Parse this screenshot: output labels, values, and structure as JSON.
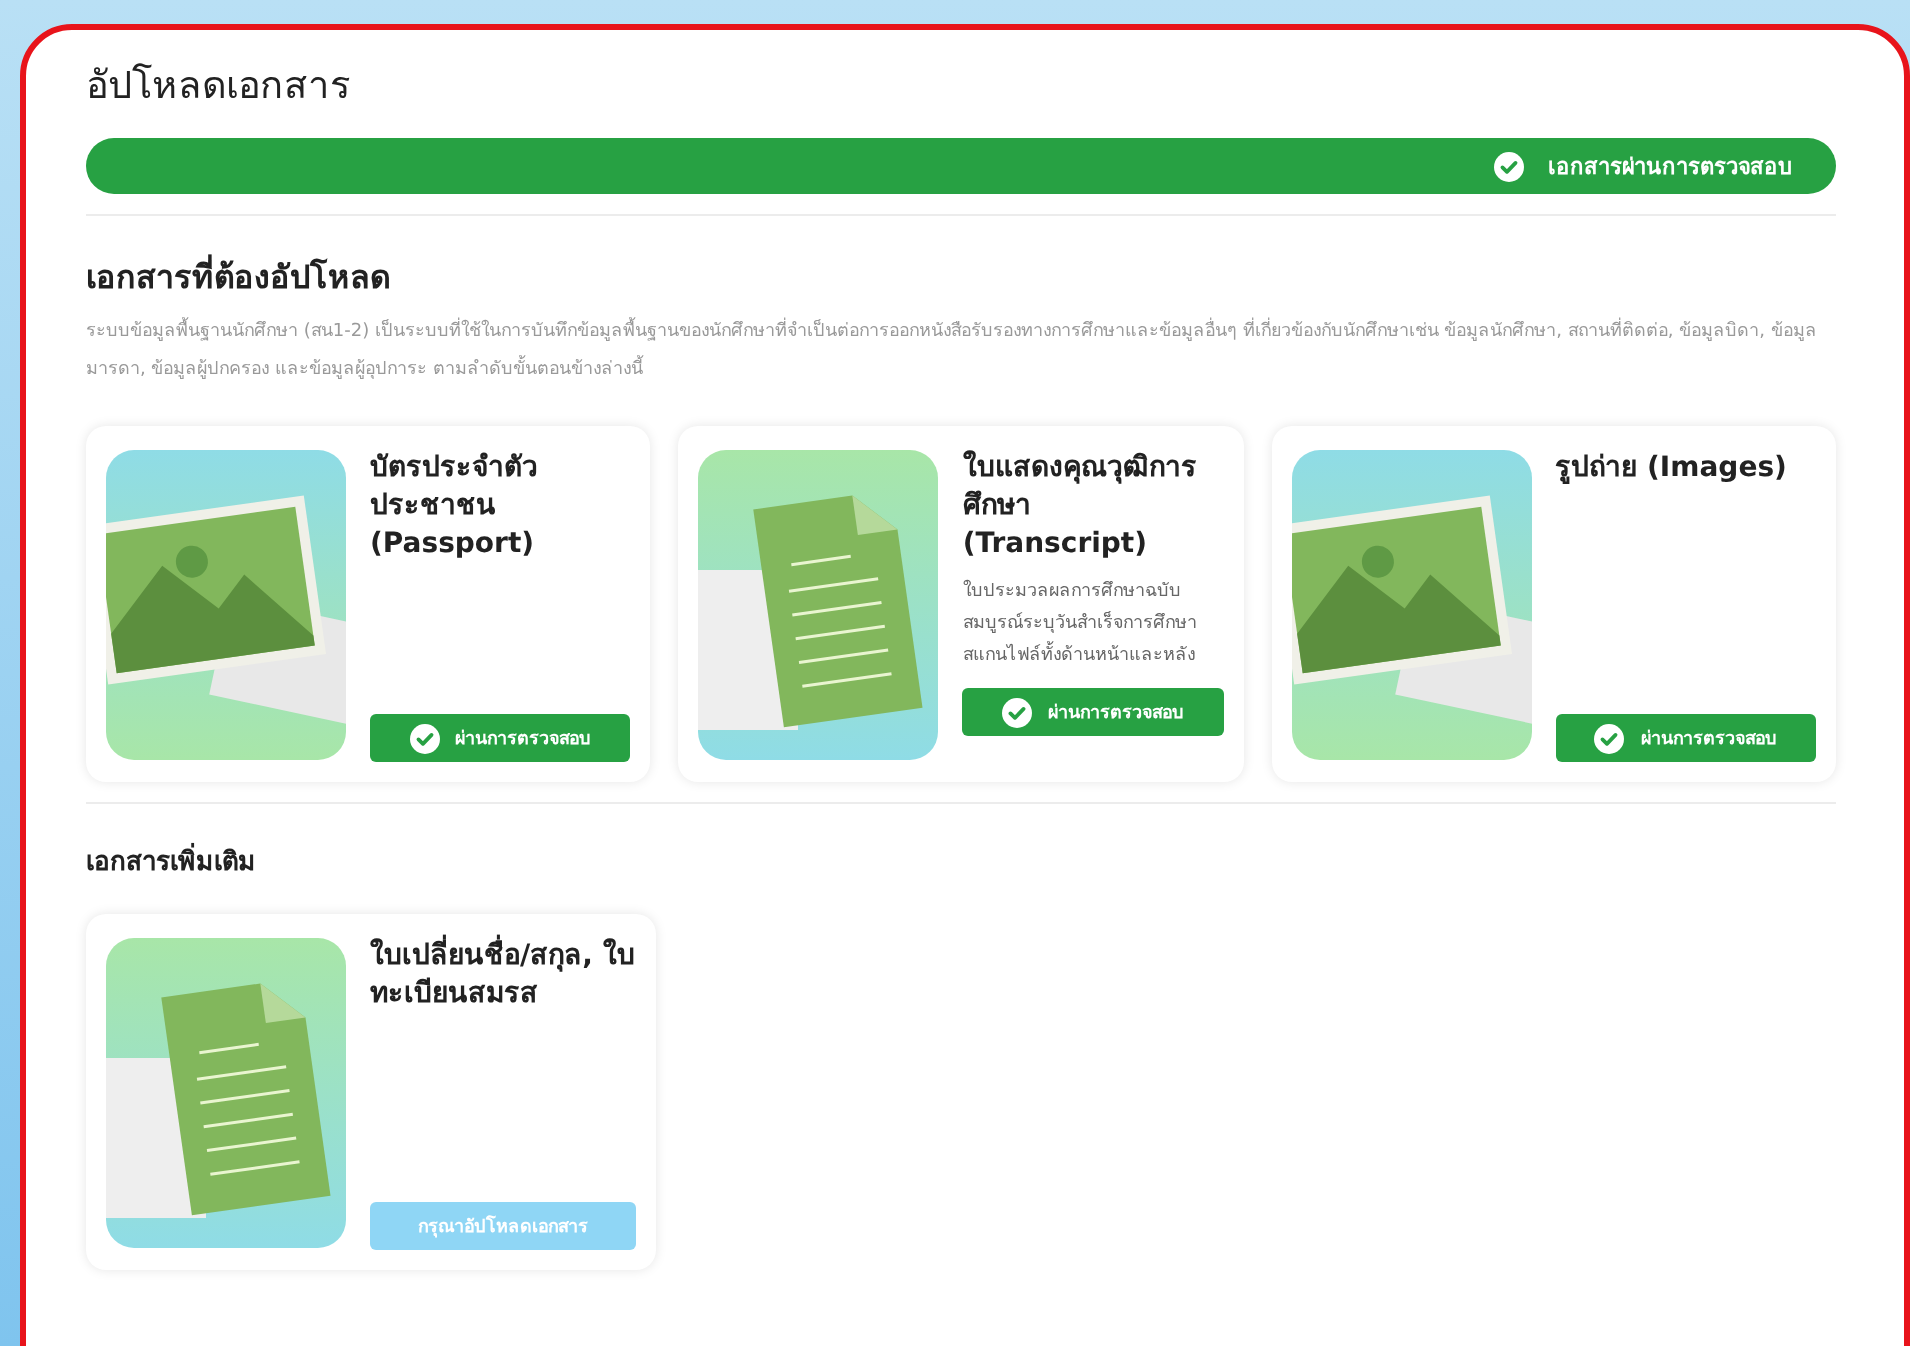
{
  "page": {
    "title": "อัปโหลดเอกสาร"
  },
  "overall_status": {
    "label": "เอกสารผ่านการตรวจสอบ",
    "verified": true
  },
  "required_section": {
    "title": "เอกสารที่ต้องอัปโหลด",
    "description": "ระบบข้อมูลพื้นฐานนักศึกษา (สน1-2) เป็นระบบที่ใช้ในการบันทึกข้อมูลพื้นฐานของนักศึกษาที่จำเป็นต่อการออกหนังสือรับรองทางการศึกษาและข้อมูลอื่นๆ ที่เกี่ยวข้องกับนักศึกษาเช่น ข้อมูลนักศึกษา, สถานที่ติดต่อ, ข้อมูลบิดา, ข้อมูลมารดา, ข้อมูลผู้ปกครอง และข้อมูลผู้อุปการะ ตามลำดับขั้นตอนข้างล่างนี้",
    "documents": [
      {
        "kind": "image",
        "title": "บัตรประจำตัวประชาชน (Passport)",
        "verified": true,
        "button": "ผ่านการตรวจสอบ"
      },
      {
        "kind": "document",
        "title": "ใบแสดงคุณวุฒิการศึกษา (Transcript)",
        "description": "ใบประมวลผลการศึกษาฉบับสมบูรณ์ระบุวันสำเร็จการศึกษา สแกนไฟล์ทั้งด้านหน้าและหลัง",
        "verified": true,
        "button": "ผ่านการตรวจสอบ"
      },
      {
        "kind": "image",
        "title": "รูปถ่าย (Images)",
        "verified": true,
        "button": "ผ่านการตรวจสอบ"
      }
    ]
  },
  "additional_section": {
    "title": "เอกสารเพิ่มเติม",
    "documents": [
      {
        "kind": "document",
        "title": "ใบเปลี่ยนชื่อ/สกุล, ใบทะเบียนสมรส",
        "verified": false,
        "button": "กรุณาอัปโหลดเอกสาร"
      }
    ]
  }
}
